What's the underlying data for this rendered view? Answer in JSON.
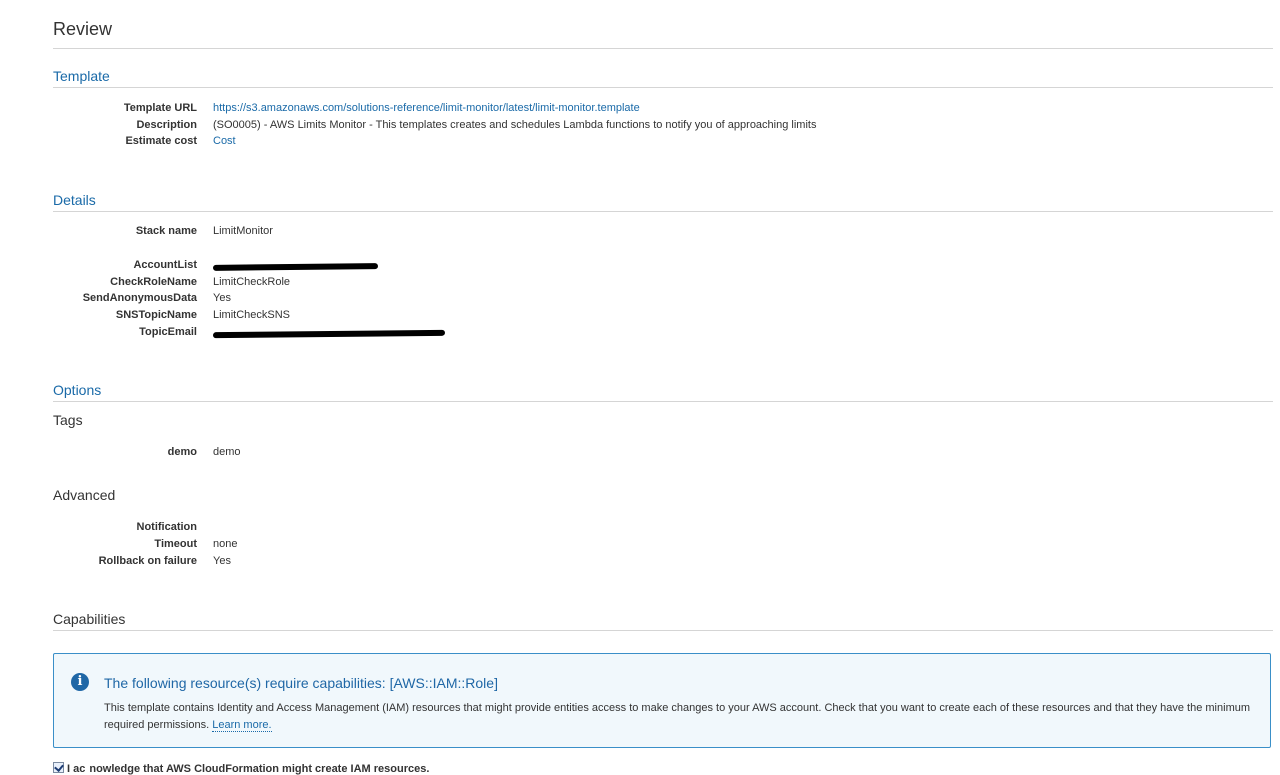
{
  "page": {
    "title": "Review"
  },
  "template": {
    "heading": "Template",
    "rows": [
      {
        "label": "Template URL",
        "value": "https://s3.amazonaws.com/solutions-reference/limit-monitor/latest/limit-monitor.template"
      },
      {
        "label": "Description",
        "value": "(SO0005) - AWS Limits Monitor - This templates creates and schedules Lambda functions to notify you of approaching limits"
      },
      {
        "label": "Estimate cost",
        "value": "Cost"
      }
    ]
  },
  "details": {
    "heading": "Details",
    "stack_name": {
      "label": "Stack name",
      "value": "LimitMonitor"
    },
    "params": [
      {
        "label": "AccountList",
        "value": ""
      },
      {
        "label": "CheckRoleName",
        "value": "LimitCheckRole"
      },
      {
        "label": "SendAnonymousData",
        "value": "Yes"
      },
      {
        "label": "SNSTopicName",
        "value": "LimitCheckSNS"
      },
      {
        "label": "TopicEmail",
        "value": ""
      }
    ]
  },
  "options": {
    "heading": "Options",
    "tags_heading": "Tags",
    "tags": [
      {
        "label": "demo",
        "value": "demo"
      }
    ],
    "advanced_heading": "Advanced",
    "advanced": [
      {
        "label": "Notification",
        "value": ""
      },
      {
        "label": "Timeout",
        "value": "none"
      },
      {
        "label": "Rollback on failure",
        "value": "Yes"
      }
    ]
  },
  "capabilities": {
    "heading": "Capabilities",
    "alert_title": "The following resource(s) require capabilities: [AWS::IAM::Role]",
    "alert_body": "This template contains Identity and Access Management (IAM) resources that might provide entities access to make changes to your AWS account. Check that you want to create each of these resources and that they have the minimum required permissions.",
    "learn_more": "Learn more.",
    "ack_prefix": "I ac",
    "ack_suffix": "nowledge that AWS CloudFormation might create IAM resources."
  },
  "colors": {
    "link": "#1a6aa8",
    "alert_border": "#3a8fc8",
    "alert_bg": "#f1f8fc",
    "info_icon": "#1f67a6"
  },
  "icons": {
    "info": "info-icon",
    "checkbox": "checkbox-checked"
  }
}
